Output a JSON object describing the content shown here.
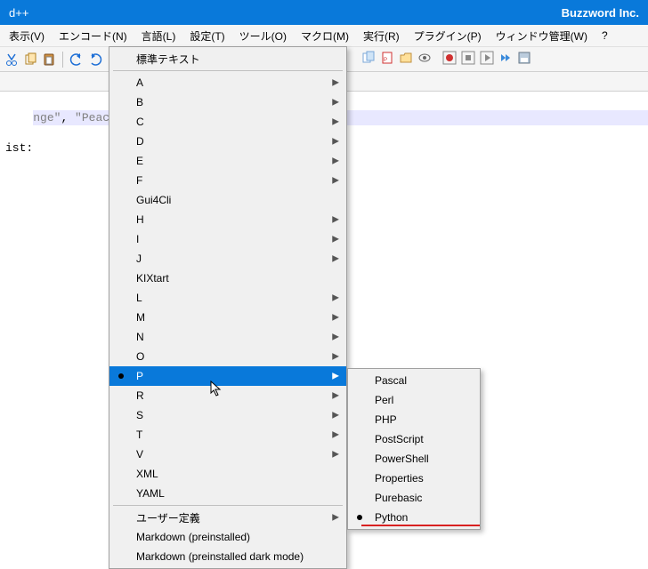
{
  "title_left": "d++",
  "title_right": "Buzzword Inc.",
  "menubar": [
    "表示(V)",
    "エンコード(N)",
    "言語(L)",
    "設定(T)",
    "ツール(O)",
    "マクロ(M)",
    "実行(R)",
    "プラグイン(P)",
    "ウィンドウ管理(W)",
    "?"
  ],
  "code": {
    "line1_a": "nge\"",
    "line1_b": ", ",
    "line1_c": "\"Peach\"",
    "line1_d": ",",
    "line2": "ist:"
  },
  "dropdown": {
    "top": "標準テキスト",
    "letters": [
      {
        "label": "A",
        "arrow": true
      },
      {
        "label": "B",
        "arrow": true
      },
      {
        "label": "C",
        "arrow": true
      },
      {
        "label": "D",
        "arrow": true
      },
      {
        "label": "E",
        "arrow": true
      },
      {
        "label": "F",
        "arrow": true
      },
      {
        "label": "Gui4Cli",
        "arrow": false
      },
      {
        "label": "H",
        "arrow": true
      },
      {
        "label": "I",
        "arrow": true
      },
      {
        "label": "J",
        "arrow": true
      },
      {
        "label": "KIXtart",
        "arrow": false
      },
      {
        "label": "L",
        "arrow": true
      },
      {
        "label": "M",
        "arrow": true
      },
      {
        "label": "N",
        "arrow": true
      },
      {
        "label": "O",
        "arrow": true
      },
      {
        "label": "P",
        "arrow": true,
        "selected": true,
        "bullet": true
      },
      {
        "label": "R",
        "arrow": true
      },
      {
        "label": "S",
        "arrow": true
      },
      {
        "label": "T",
        "arrow": true
      },
      {
        "label": "V",
        "arrow": true
      },
      {
        "label": "XML",
        "arrow": false
      },
      {
        "label": "YAML",
        "arrow": false
      }
    ],
    "bottom": [
      {
        "label": "ユーザー定義",
        "arrow": true
      },
      {
        "label": "Markdown (preinstalled)",
        "arrow": false
      },
      {
        "label": "Markdown (preinstalled dark mode)",
        "arrow": false
      }
    ]
  },
  "submenu": [
    {
      "label": "Pascal"
    },
    {
      "label": "Perl"
    },
    {
      "label": "PHP"
    },
    {
      "label": "PostScript"
    },
    {
      "label": "PowerShell"
    },
    {
      "label": "Properties"
    },
    {
      "label": "Purebasic"
    },
    {
      "label": "Python",
      "bullet": true
    }
  ]
}
